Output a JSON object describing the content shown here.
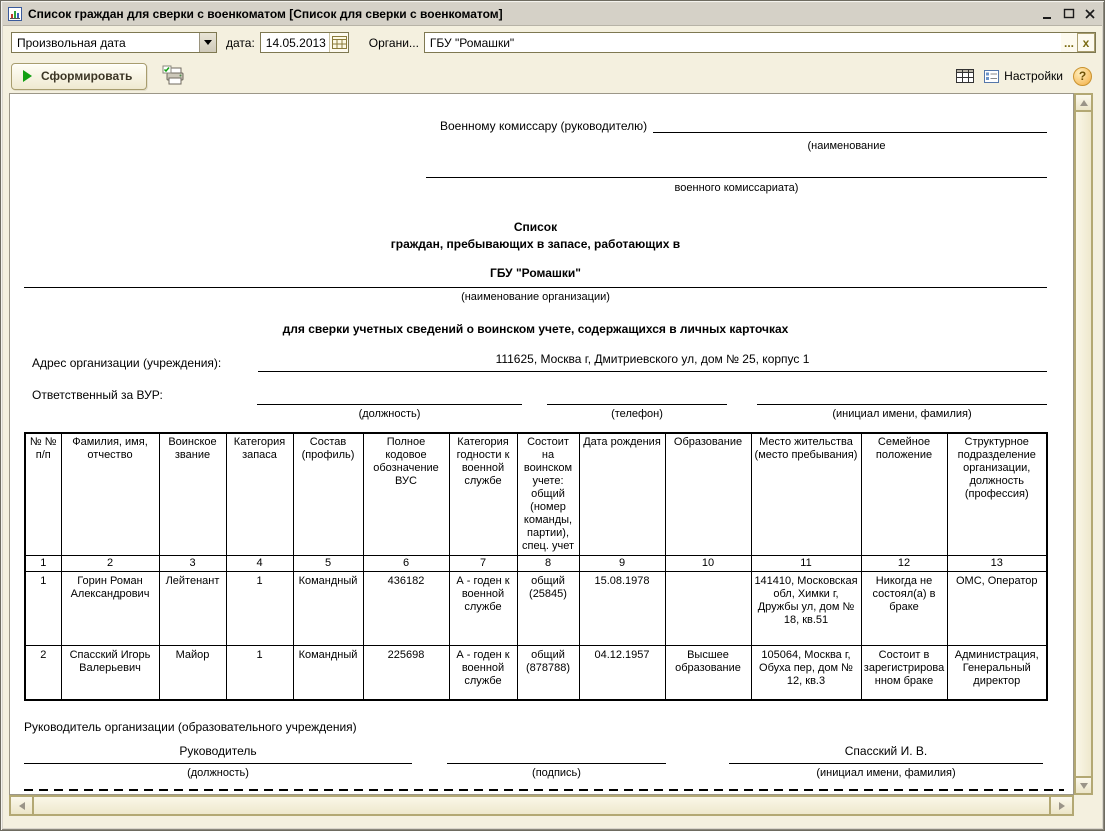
{
  "window": {
    "title": "Список граждан для сверки с военкоматом [Список для сверки с военкоматом]"
  },
  "toolbar": {
    "period_value": "Произвольная дата",
    "date_label": "дата:",
    "date_value": "14.05.2013",
    "org_label": "Органи...",
    "org_value": "ГБУ \"Ромашки\"",
    "org_ellipsis": "...",
    "org_clear": "x",
    "generate_label": "Сформировать",
    "settings_label": "Настройки",
    "help_label": "?"
  },
  "colors": {
    "toolbar_bg": "#f4f0df",
    "button_face": "#efe9d0",
    "play_green": "#12a012",
    "help_orange": "#f3ad41",
    "scrollbar_face": "#eee8cd"
  },
  "doc": {
    "addressee": "Военному комиссару (руководителю)",
    "addressee_hint_1": "(наименование",
    "addressee_hint_2": "военного комиссариата)",
    "title_line_1": "Список",
    "title_line_2": "граждан, пребывающих в запасе, работающих в",
    "org_name": "ГБУ \"Ромашки\"",
    "org_hint": "(наименование организации)",
    "purpose": "для сверки учетных сведений о воинском учете, содержащихся в личных карточках",
    "address_label": "Адрес организации (учреждения):",
    "address_value": "111625, Москва г, Дмитриевского ул, дом № 25, корпус 1",
    "responsible_label": "Ответственный за ВУР:",
    "hint_position": "(должность)",
    "hint_phone": "(телефон)",
    "hint_name": "(инициал имени, фамилия)",
    "hint_sign": "(подпись)",
    "table": {
      "headers": [
        "№ № п/п",
        "Фамилия, имя, отчество",
        "Воинское звание",
        "Категория запаса",
        "Состав (профиль)",
        "Полное кодовое обозначение ВУС",
        "Категория годности к военной службе",
        "Состоит на воинском учете: общий (номер команды, партии), спец. учет",
        "Дата рождения",
        "Образование",
        "Место жительства (место пребывания)",
        "Семейное положение",
        "Структурное подразделение организации, должность (профессия)"
      ],
      "nums": [
        "1",
        "2",
        "3",
        "4",
        "5",
        "6",
        "7",
        "8",
        "9",
        "10",
        "11",
        "12",
        "13"
      ],
      "rows": [
        [
          "1",
          "Горин Роман Александрович",
          "Лейтенант",
          "1",
          "Командный",
          "436182",
          "А - годен к военной службе",
          "общий (25845)",
          "15.08.1978",
          "",
          "141410, Московская обл, Химки г, Дружбы ул, дом № 18, кв.51",
          "Никогда не состоял(а) в браке",
          "ОМС, Оператор"
        ],
        [
          "2",
          "Спасский Игорь Валерьевич",
          "Майор",
          "1",
          "Командный",
          "225698",
          "А - годен к военной службе",
          "общий (878788)",
          "04.12.1957",
          "Высшее образование",
          "105064, Москва г, Обуха пер, дом № 12, кв.3",
          "Состоит в зарегистрированном браке",
          "Администрация, Генеральный директор"
        ]
      ]
    },
    "footer_label": "Руководитель организации (образовательного учреждения)",
    "sig_position_value": "Руководитель",
    "sig_name_value": "Спасский И. В."
  }
}
